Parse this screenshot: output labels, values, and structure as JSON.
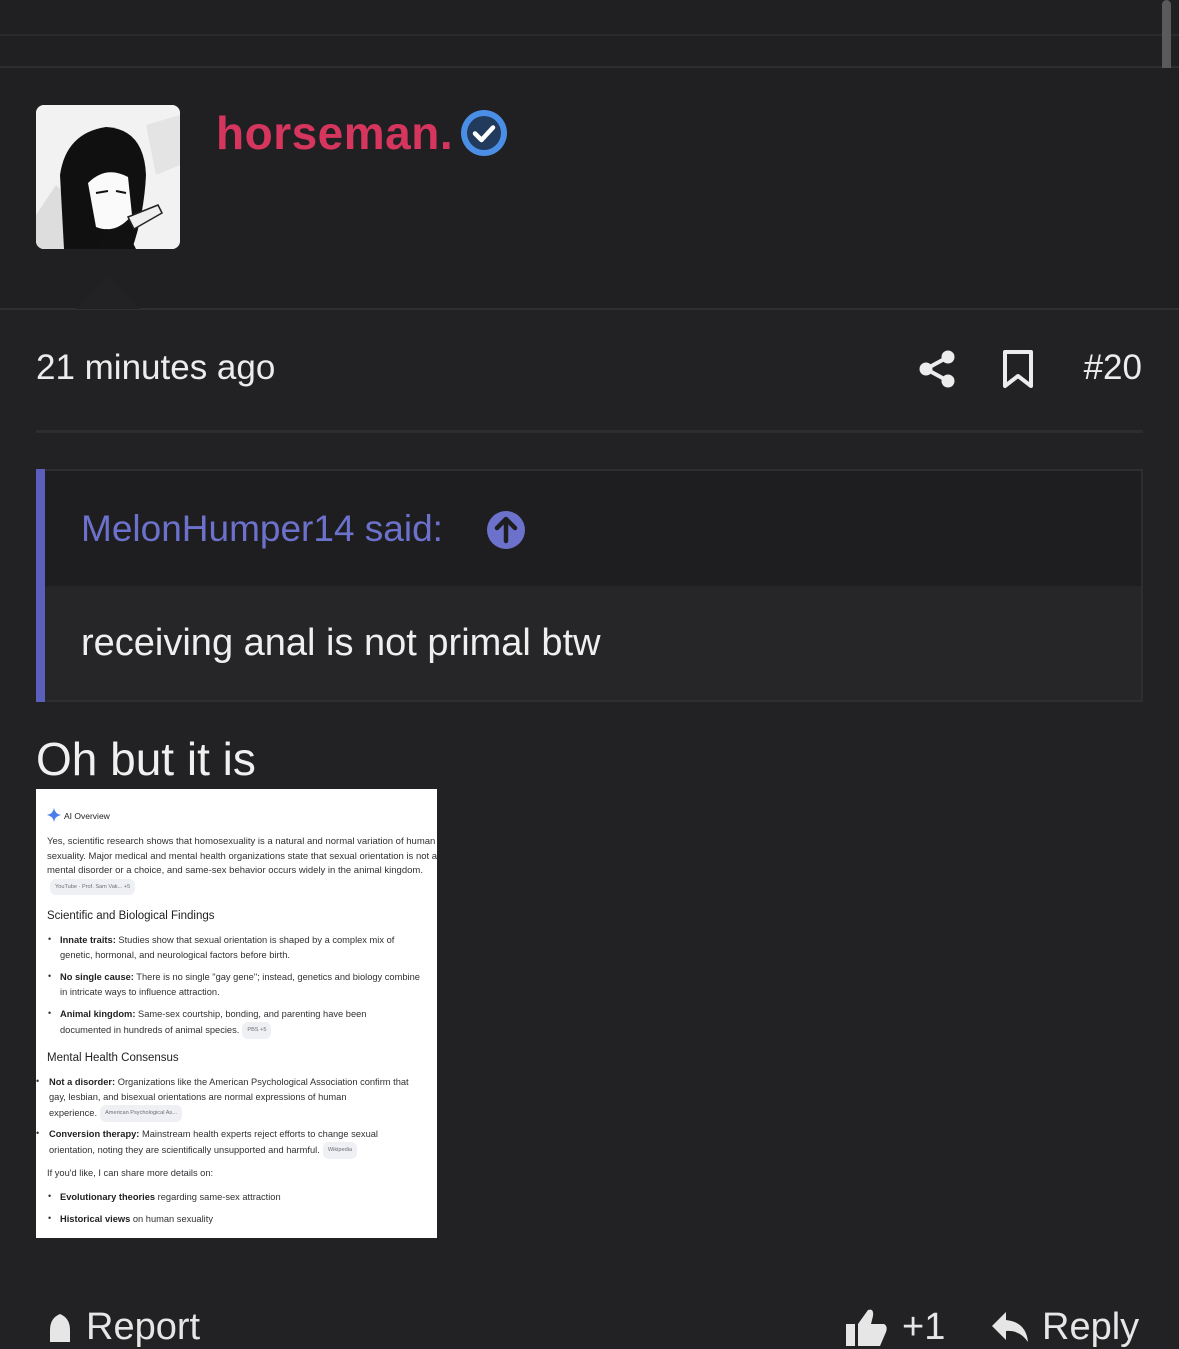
{
  "post": {
    "username": "horseman.",
    "timestamp": "21 minutes ago",
    "post_number": "#20",
    "reply_text": "Oh but it is"
  },
  "quote": {
    "author_line": "MelonHumper14 said:",
    "text": "receiving anal is not primal btw"
  },
  "ai_overview": {
    "header": "AI Overview",
    "intro": "Yes, scientific research shows that homosexuality is a natural and normal variation of human sexuality. Major medical and mental health organizations state that sexual orientation is not a mental disorder or a choice, and same-sex behavior occurs widely in the animal kingdom.",
    "intro_chip": "YouTube · Prof. Sam Vak... +5",
    "section1_title": "Scientific and Biological Findings",
    "s1_items": [
      {
        "bold": "Innate traits:",
        "text": " Studies show that sexual orientation is shaped by a complex mix of",
        "text2": "genetic, hormonal, and neurological factors before birth."
      },
      {
        "bold": "No single cause:",
        "text": " There is no single \"gay gene\"; instead, genetics and biology combine",
        "text2": "in intricate ways to influence attraction."
      },
      {
        "bold": "Animal kingdom:",
        "text": " Same-sex courtship, bonding, and parenting have been",
        "text2": "documented in hundreds of animal species."
      }
    ],
    "s1_chip": "PBS +5",
    "section2_title": "Mental Health Consensus",
    "s2_items": [
      {
        "bold": "Not a disorder:",
        "text": " Organizations like the American Psychological Association confirm that",
        "text2": "gay, lesbian, and bisexual orientations are normal expressions of human",
        "text3": "experience."
      },
      {
        "bold": "Conversion therapy:",
        "text": " Mainstream health experts reject efforts to change sexual",
        "text2": "orientation, noting they are scientifically unsupported and harmful."
      }
    ],
    "s2_chip_a": "American Psychological As...",
    "s2_chip_b": "Wikipedia",
    "share_more": "If you'd like, I can share more details on:",
    "more_items": [
      {
        "bold": "Evolutionary theories",
        "text": " regarding same-sex attraction"
      },
      {
        "bold": "Historical views",
        "text": " on human sexuality"
      }
    ]
  },
  "footer": {
    "report_label": "Report",
    "like_count": "+1",
    "reply_label": "Reply"
  },
  "colors": {
    "background": "#222224",
    "username": "#d6365e",
    "verified": "#4a8ee6",
    "quote_accent": "#5a5fbb",
    "quote_author": "#6c72cc"
  },
  "icons": [
    "verified-badge-icon",
    "share-icon",
    "bookmark-icon",
    "arrow-up-circle-icon",
    "report-icon",
    "thumbs-up-icon",
    "reply-arrow-icon",
    "sparkle-icon"
  ]
}
